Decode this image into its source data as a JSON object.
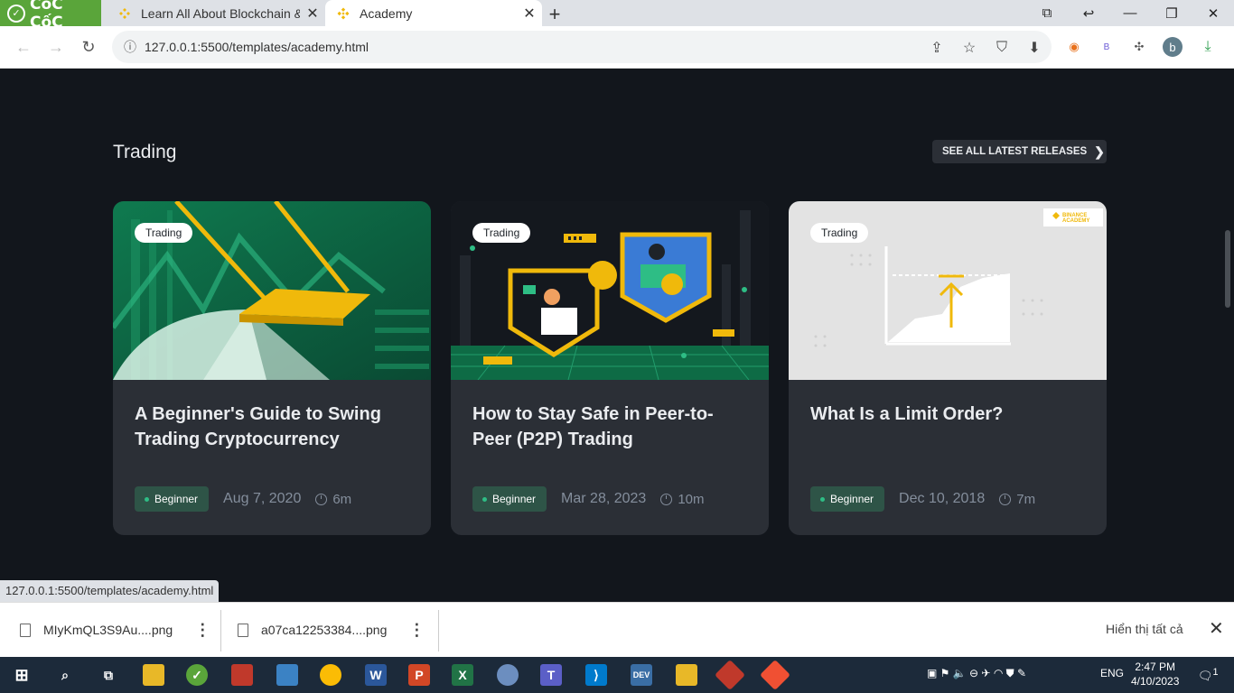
{
  "browser": {
    "brand": "CốC CốC",
    "tabs": [
      {
        "label": "Learn All About Blockchain &",
        "close": "✕"
      },
      {
        "label": "Academy",
        "close": "✕"
      }
    ],
    "new_tab": "+",
    "url": "127.0.0.1:5500/templates/academy.html",
    "profile_initial": "b"
  },
  "section": {
    "title": "Trading",
    "see_all": "SEE ALL LATEST RELEASES"
  },
  "cards": [
    {
      "tag": "Trading",
      "title": "A Beginner's Guide to Swing Trading Cryptocurrency",
      "level": "Beginner",
      "date": "Aug 7, 2020",
      "duration": "6m"
    },
    {
      "tag": "Trading",
      "title": "How to Stay Safe in Peer-to-Peer (P2P) Trading",
      "level": "Beginner",
      "date": "Mar 28, 2023",
      "duration": "10m"
    },
    {
      "tag": "Trading",
      "title": "What Is a Limit Order?",
      "level": "Beginner",
      "date": "Dec 10, 2018",
      "duration": "7m",
      "brand": "BINANCE ACADEMY"
    }
  ],
  "status_url": "127.0.0.1:5500/templates/academy.html",
  "downloads": {
    "items": [
      {
        "name": "MIyKmQL3S9Au....png"
      },
      {
        "name": "a07ca12253384....png"
      }
    ],
    "show_all": "Hiển thị tất cả"
  },
  "taskbar": {
    "lang": "ENG",
    "time": "2:47 PM",
    "date": "4/10/2023",
    "notifications": "1"
  },
  "colors": {
    "accent": "#f0b90b",
    "badge_bg": "#2e5447",
    "card_bg": "#2b2f36",
    "page_bg": "#12161c"
  }
}
